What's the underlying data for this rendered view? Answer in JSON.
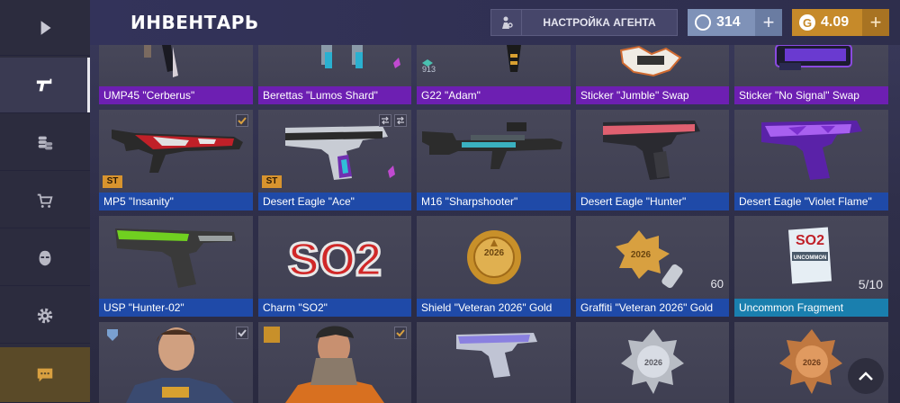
{
  "header": {
    "title": "ИНВЕНТАРЬ",
    "agent_button": "НАСТРОЙКА АГЕНТА",
    "silver_balance": "314",
    "gold_balance": "4.09",
    "plus": "+"
  },
  "sidebar": {
    "items": [
      {
        "icon": "play-icon"
      },
      {
        "icon": "pistol-icon",
        "active": true
      },
      {
        "icon": "coins-icon"
      },
      {
        "icon": "cart-icon"
      },
      {
        "icon": "mask-icon"
      },
      {
        "icon": "gear-icon"
      },
      {
        "icon": "chat-icon"
      }
    ]
  },
  "inventory": {
    "row1": [
      {
        "name": "UMP45 \"Cerberus\""
      },
      {
        "name": "Berettas \"Lumos Shard\""
      },
      {
        "name": "G22 \"Adam\"",
        "qty": "913"
      },
      {
        "name": "Sticker \"Jumble\" Swap"
      },
      {
        "name": "Sticker \"No Signal\" Swap"
      }
    ],
    "row2": [
      {
        "name": "MP5 \"Insanity\"",
        "st": "ST"
      },
      {
        "name": "Desert Eagle \"Ace\"",
        "st": "ST"
      },
      {
        "name": "M16 \"Sharpshooter\""
      },
      {
        "name": "Desert Eagle \"Hunter\""
      },
      {
        "name": "Desert Eagle \"Violet Flame\""
      }
    ],
    "row3": [
      {
        "name": "USP \"Hunter-02\""
      },
      {
        "name": "Charm \"SO2\"",
        "art_text": "SO2"
      },
      {
        "name": "Shield \"Veteran 2026\" Gold",
        "art_text": "2026"
      },
      {
        "name": "Graffiti \"Veteran 2026\" Gold",
        "count": "60",
        "art_text": "2026"
      },
      {
        "name": "Uncommon Fragment",
        "count": "5/10",
        "art_text": "SO2",
        "art_subtext": "UNCOMMON"
      }
    ],
    "row4": [
      {
        "name": ""
      },
      {
        "name": ""
      },
      {
        "name": ""
      },
      {
        "name": "",
        "art_text": "2026"
      },
      {
        "name": "",
        "art_text": "2026"
      }
    ]
  },
  "colors": {
    "purple": "#6d1fb2",
    "blue": "#1f4aa8",
    "teal": "#1a7fae",
    "gold": "#c68a2a",
    "silver": "#7f92b8"
  }
}
